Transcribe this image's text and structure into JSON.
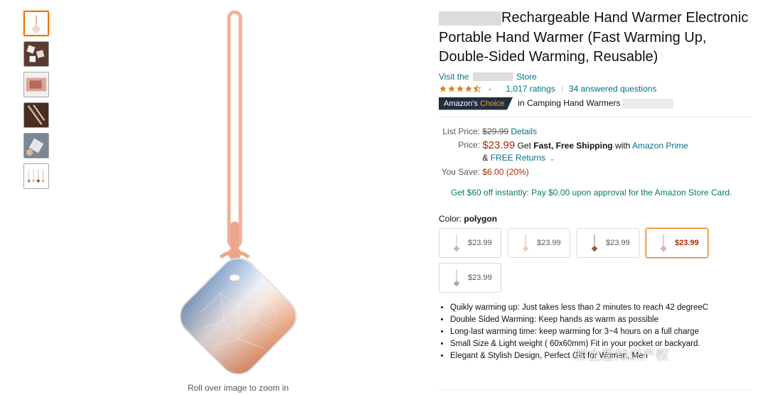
{
  "product": {
    "title": "Rechargeable Hand Warmer Electronic Portable Hand Warmer (Fast Warming Up, Double-Sided Warming, Reusable)",
    "store_prefix": "Visit the",
    "store_suffix": "Store",
    "rating_count": "1,017 ratings",
    "answered": "34 answered questions",
    "rating_value": 4.5,
    "badge_amazons": "Amazon's",
    "badge_choice": "Choice",
    "badge_category": "in Camping Hand Warmers"
  },
  "pricing": {
    "list_label": "List Price:",
    "list_price": "$29.99",
    "details_link": "Details",
    "price_label": "Price:",
    "price": "$23.99",
    "get": "Get",
    "free_shipping": "Fast, Free Shipping",
    "with": "with",
    "prime": "Amazon Prime",
    "amp": "&",
    "free_returns": "FREE Returns",
    "save_label": "You Save:",
    "save_value": "$6.00 (20%)"
  },
  "card_offer": "Get $60 off instantly: Pay $0.00 upon approval for the Amazon Store Card.",
  "color": {
    "label": "Color:",
    "selected": "polygon",
    "options": [
      {
        "price": "$23.99",
        "tint": "#b9b9bd"
      },
      {
        "price": "$23.99",
        "tint": "#e9cdbb"
      },
      {
        "price": "$23.99",
        "tint": "#8b5a3c"
      },
      {
        "price": "$23.99",
        "tint": "#e7b8a2"
      },
      {
        "price": "$23.99",
        "tint": "#a9a9a9"
      }
    ]
  },
  "bullets": [
    "Quikly warming up: Just takes less than 2 minutes to reach 42 degreeC",
    "Double Sided Warming: Keep hands as warm as possible",
    "Long-last warming time: keep warming for 3~4 hours on a full charge",
    "Small Size & Light weight ( 60x60mm) Fit in your pocket or backyard.",
    "Elegant & Stylish Design, Perfect Gift for Women, Men"
  ],
  "zoom_hint": "Roll over image to zoom in",
  "watermark": "知企星知识产权",
  "colors": {
    "link": "#007185",
    "price": "#b12704",
    "accent": "#e77600",
    "green": "#067d62"
  }
}
